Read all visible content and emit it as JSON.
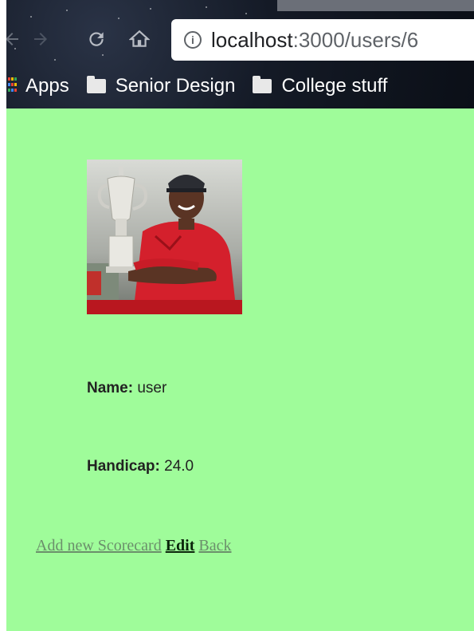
{
  "browser": {
    "url_host": "localhost",
    "url_path": ":3000/users/6",
    "bookmarks": [
      {
        "label": "Apps",
        "icon": "apps-grid-icon"
      },
      {
        "label": "Senior Design",
        "icon": "folder-icon"
      },
      {
        "label": "College stuff",
        "icon": "folder-icon"
      }
    ]
  },
  "user": {
    "name_label": "Name:",
    "name_value": "user",
    "handicap_label": "Handicap:",
    "handicap_value": "24.0"
  },
  "links": {
    "add_scorecard": "Add new Scorecard",
    "edit": "Edit",
    "back": "Back"
  },
  "colors": {
    "page_background": "#9ffc9a",
    "link_muted": "#6b8f6b",
    "link_strong": "#0a240a"
  }
}
